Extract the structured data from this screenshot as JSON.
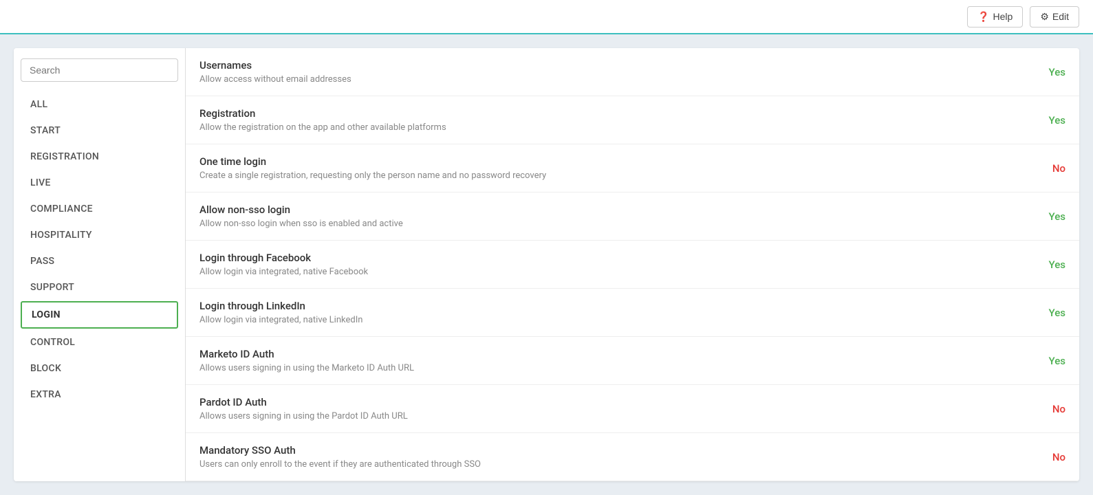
{
  "topbar": {
    "help_label": "Help",
    "edit_label": "Edit"
  },
  "sidebar": {
    "search_placeholder": "Search",
    "nav_items": [
      {
        "id": "all",
        "label": "ALL",
        "active": false
      },
      {
        "id": "start",
        "label": "START",
        "active": false
      },
      {
        "id": "registration",
        "label": "REGISTRATION",
        "active": false
      },
      {
        "id": "live",
        "label": "LIVE",
        "active": false
      },
      {
        "id": "compliance",
        "label": "COMPLIANCE",
        "active": false
      },
      {
        "id": "hospitality",
        "label": "HOSPITALITY",
        "active": false
      },
      {
        "id": "pass",
        "label": "PASS",
        "active": false
      },
      {
        "id": "support",
        "label": "SUPPORT",
        "active": false
      },
      {
        "id": "login",
        "label": "LOGIN",
        "active": true
      },
      {
        "id": "control",
        "label": "CONTROL",
        "active": false
      },
      {
        "id": "block",
        "label": "BLOCK",
        "active": false
      },
      {
        "id": "extra",
        "label": "EXTRA",
        "active": false
      }
    ]
  },
  "features": [
    {
      "title": "Usernames",
      "description": "Allow access without email addresses",
      "value": "Yes",
      "value_type": "yes"
    },
    {
      "title": "Registration",
      "description": "Allow the registration on the app and other available platforms",
      "value": "Yes",
      "value_type": "yes"
    },
    {
      "title": "One time login",
      "description": "Create a single registration, requesting only the person name and no password recovery",
      "value": "No",
      "value_type": "no"
    },
    {
      "title": "Allow non-sso login",
      "description": "Allow non-sso login when sso is enabled and active",
      "value": "Yes",
      "value_type": "yes"
    },
    {
      "title": "Login through Facebook",
      "description": "Allow login via integrated, native Facebook",
      "value": "Yes",
      "value_type": "yes"
    },
    {
      "title": "Login through LinkedIn",
      "description": "Allow login via integrated, native LinkedIn",
      "value": "Yes",
      "value_type": "yes"
    },
    {
      "title": "Marketo ID Auth",
      "description": "Allows users signing in using the Marketo ID Auth URL",
      "value": "Yes",
      "value_type": "yes"
    },
    {
      "title": "Pardot ID Auth",
      "description": "Allows users signing in using the Pardot ID Auth URL",
      "value": "No",
      "value_type": "no"
    },
    {
      "title": "Mandatory SSO Auth",
      "description": "Users can only enroll to the event if they are authenticated through SSO",
      "value": "No",
      "value_type": "no"
    }
  ]
}
